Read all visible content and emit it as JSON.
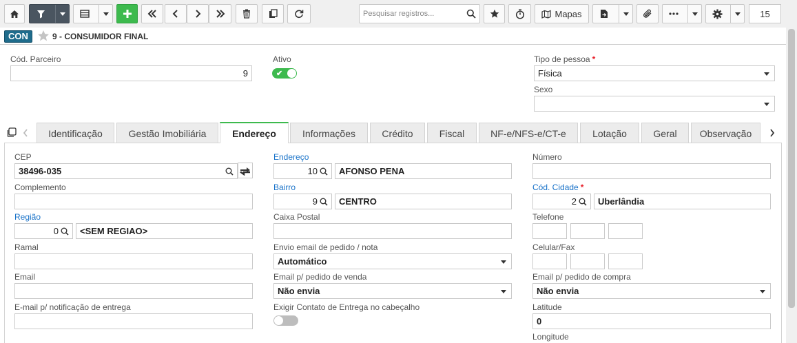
{
  "toolbar": {
    "search_placeholder": "Pesquisar registros...",
    "mapas_label": "Mapas",
    "page_number": "15"
  },
  "record": {
    "badge": "CON",
    "title": "9 - CONSUMIDOR FINAL"
  },
  "header_form": {
    "cod_parceiro_label": "Cód. Parceiro",
    "cod_parceiro_value": "9",
    "ativo_label": "Ativo",
    "tipo_pessoa_label": "Tipo de pessoa",
    "tipo_pessoa_value": "Física",
    "sexo_label": "Sexo",
    "sexo_value": ""
  },
  "tabs": [
    {
      "label": "Identificação"
    },
    {
      "label": "Gestão Imobiliária"
    },
    {
      "label": "Endereço"
    },
    {
      "label": "Informações"
    },
    {
      "label": "Crédito"
    },
    {
      "label": "Fiscal"
    },
    {
      "label": "NF-e/NFS-e/CT-e"
    },
    {
      "label": "Lotação"
    },
    {
      "label": "Geral"
    },
    {
      "label": "Observação"
    }
  ],
  "endereco": {
    "cep_label": "CEP",
    "cep_value": "38496-035",
    "endereco_label": "Endereço",
    "endereco_code": "10",
    "endereco_name": "AFONSO PENA",
    "numero_label": "Número",
    "complemento_label": "Complemento",
    "bairro_label": "Bairro",
    "bairro_code": "9",
    "bairro_name": "CENTRO",
    "cod_cidade_label": "Cód. Cidade",
    "cod_cidade_code": "2",
    "cod_cidade_name": "Uberlândia",
    "regiao_label": "Região",
    "regiao_code": "0",
    "regiao_name": "<SEM REGIAO>",
    "caixa_postal_label": "Caixa Postal",
    "telefone_label": "Telefone",
    "ramal_label": "Ramal",
    "envio_email_label": "Envio email de pedido / nota",
    "envio_email_value": "Automático",
    "celular_label": "Celular/Fax",
    "email_label": "Email",
    "email_venda_label": "Email p/ pedido de venda",
    "email_venda_value": "Não envia",
    "email_compra_label": "Email p/ pedido de compra",
    "email_compra_value": "Não envia",
    "email_entrega_label": "E-mail p/ notificação de entrega",
    "exigir_contato_label": "Exigir Contato de Entrega no cabeçalho",
    "latitude_label": "Latitude",
    "latitude_value": "0",
    "longitude_label": "Longitude"
  },
  "colors": {
    "accent_green": "#3dba4e",
    "badge_blue": "#1f6c8c",
    "link_blue": "#1a73c9",
    "required_red": "#e8202a"
  },
  "icons": [
    "home-icon",
    "filter-icon",
    "grid-icon",
    "add-icon",
    "first-icon",
    "prev-icon",
    "next-icon",
    "last-icon",
    "trash-icon",
    "copy-icon",
    "refresh-icon",
    "search-icon",
    "star-icon",
    "timer-icon",
    "map-icon",
    "export-icon",
    "attach-icon",
    "more-icon",
    "gear-icon",
    "duplicate-icon",
    "swap-icon"
  ]
}
